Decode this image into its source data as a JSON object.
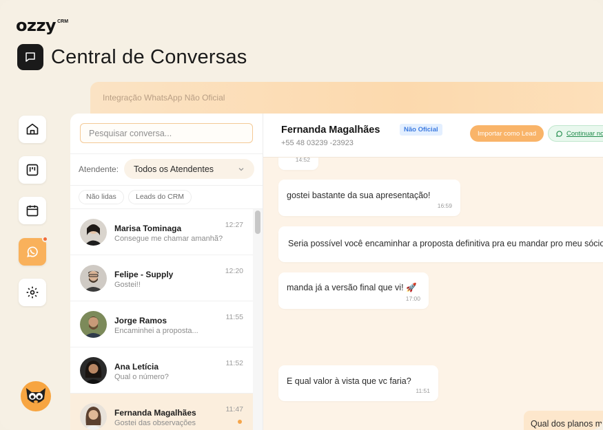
{
  "app": {
    "logo_text": "ozzy",
    "logo_sup": "CRM",
    "page_title": "Central de Conversas"
  },
  "integration_banner": "Integração WhatsApp Não Oficial",
  "sidebar": {
    "items": [
      {
        "icon": "home-icon"
      },
      {
        "icon": "kanban-icon"
      },
      {
        "icon": "calendar-icon"
      },
      {
        "icon": "whatsapp-icon",
        "active": true,
        "has_notification": true
      },
      {
        "icon": "gear-icon"
      }
    ]
  },
  "list": {
    "search_placeholder": "Pesquisar conversa...",
    "attendant_label": "Atendente:",
    "attendant_value": "Todos os Atendentes",
    "filters": [
      "Não lidas",
      "Leads do CRM"
    ],
    "conversations": [
      {
        "name": "Marisa Tominaga",
        "preview": "Consegue me chamar amanhã?",
        "time": "12:27"
      },
      {
        "name": "Felipe - Supply",
        "preview": "Gostei!!",
        "time": "12:20"
      },
      {
        "name": "Jorge Ramos",
        "preview": "Encaminhei a proposta...",
        "time": "11:55"
      },
      {
        "name": "Ana Letícia",
        "preview": "Qual o número?",
        "time": "11:52"
      },
      {
        "name": "Fernanda Magalhães",
        "preview": "Gostei das observações",
        "time": "11:47",
        "selected": true,
        "unread": true
      }
    ]
  },
  "chat": {
    "contact_name": "Fernanda Magalhães",
    "contact_phone": "+55 48 03239 -23923",
    "badge": "Não Oficial",
    "import_button": "Importar como Lead",
    "continue_button": "Continuar no",
    "messages": [
      {
        "text": "",
        "time": "14:52"
      },
      {
        "text": "gostei bastante da sua apresentação!",
        "time": "16:59"
      },
      {
        "text": "Seria possível você encaminhar a proposta definitiva pra eu mandar pro meu sócio",
        "time": ""
      },
      {
        "text": "manda já a versão final que vi! 🚀",
        "time": "17:00"
      },
      {
        "text": "E qual valor à vista que vc faria?",
        "time": "11:51"
      }
    ],
    "outgoing": {
      "text": "Qual dos planos ma"
    }
  },
  "colors": {
    "accent": "#f9b15b",
    "background": "#f6f0e4",
    "brand_dark": "#1a1a1a"
  }
}
